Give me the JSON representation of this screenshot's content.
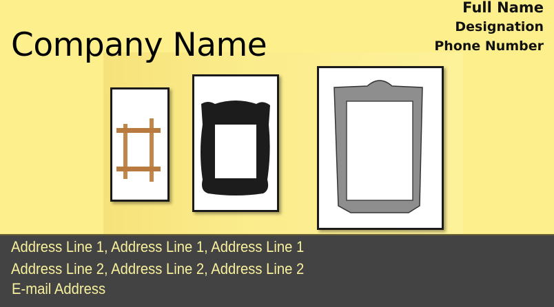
{
  "card": {
    "company_name": "Company Name",
    "full_name": "Full Name",
    "designation": "Designation",
    "phone": "Phone Number",
    "address_line_1": "Address Line 1, Address Line 1, Address Line 1",
    "address_line_2": "Address Line 2, Address Line 2, Address Line 2",
    "email": "E-mail Address"
  },
  "colors": {
    "background": "#fdf08c",
    "footer": "#434343",
    "footer_text": "#f7f09c"
  }
}
